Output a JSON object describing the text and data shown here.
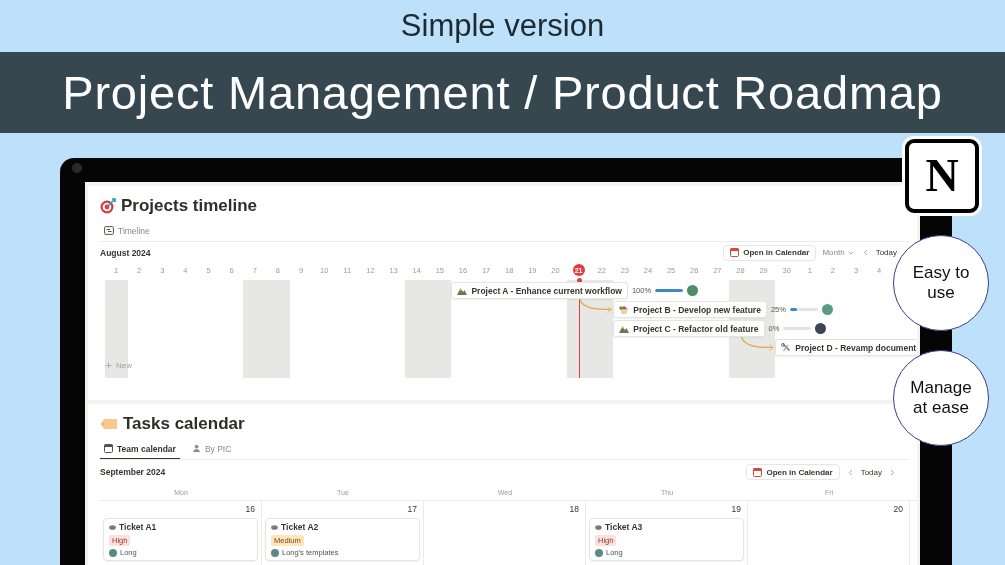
{
  "header": {
    "caption": "Simple version",
    "title": "Project Management / Product Roadmap"
  },
  "logo": {
    "letter": "N"
  },
  "badges": [
    "Easy to use",
    "Manage at ease"
  ],
  "timeline": {
    "title": "Projects timeline",
    "tab": "Timeline",
    "month": "August 2024",
    "open_calendar": "Open in Calendar",
    "scale": "Month",
    "today": "Today",
    "new": "New",
    "days": [
      {
        "label": "1",
        "shaded": true,
        "today": false
      },
      {
        "label": "2",
        "shaded": false,
        "today": false
      },
      {
        "label": "3",
        "shaded": false,
        "today": false
      },
      {
        "label": "4",
        "shaded": false,
        "today": false
      },
      {
        "label": "5",
        "shaded": false,
        "today": false
      },
      {
        "label": "6",
        "shaded": false,
        "today": false
      },
      {
        "label": "7",
        "shaded": true,
        "today": false
      },
      {
        "label": "8",
        "shaded": true,
        "today": false
      },
      {
        "label": "9",
        "shaded": false,
        "today": false
      },
      {
        "label": "10",
        "shaded": false,
        "today": false
      },
      {
        "label": "11",
        "shaded": false,
        "today": false
      },
      {
        "label": "12",
        "shaded": false,
        "today": false
      },
      {
        "label": "13",
        "shaded": false,
        "today": false
      },
      {
        "label": "14",
        "shaded": true,
        "today": false
      },
      {
        "label": "15",
        "shaded": true,
        "today": false
      },
      {
        "label": "16",
        "shaded": false,
        "today": false,
        "bars": [
          {
            "label": "Project A - Enhance current workflow",
            "progress": "100%",
            "level": 1,
            "avatar": {
              "color": "#4f8a6b"
            },
            "links_next": true
          }
        ]
      },
      {
        "label": "17",
        "shaded": false,
        "today": false
      },
      {
        "label": "18",
        "shaded": false,
        "today": false
      },
      {
        "label": "19",
        "shaded": false,
        "today": false
      },
      {
        "label": "20",
        "shaded": false,
        "today": false
      },
      {
        "label": "21",
        "shaded": true,
        "today": true
      },
      {
        "label": "22",
        "shaded": true,
        "today": false
      },
      {
        "label": "23",
        "shaded": false,
        "today": false,
        "bars": [
          {
            "label": "Project B - Develop new feature",
            "progress": "25%",
            "level": 0.25,
            "avatar": {
              "color": "#5b9a8a"
            },
            "links_next": false
          },
          {
            "label": "Project C - Refactor old feature",
            "progress": "0%",
            "level": 0,
            "avatar": {
              "color": "#3d4552"
            },
            "links_next": true
          }
        ]
      },
      {
        "label": "24",
        "shaded": false,
        "today": false
      },
      {
        "label": "25",
        "shaded": false,
        "today": false
      },
      {
        "label": "26",
        "shaded": false,
        "today": false
      },
      {
        "label": "27",
        "shaded": false,
        "today": false
      },
      {
        "label": "28",
        "shaded": true,
        "today": false
      },
      {
        "label": "29",
        "shaded": true,
        "today": false
      },
      {
        "label": "30",
        "shaded": false,
        "today": false,
        "bars": [
          {
            "label": "Project D - Revamp document",
            "links_next": false
          }
        ]
      },
      {
        "label": "1",
        "shaded": false,
        "today": false
      },
      {
        "label": "2",
        "shaded": false,
        "today": false
      },
      {
        "label": "3",
        "shaded": false,
        "today": false
      },
      {
        "label": "4",
        "shaded": false,
        "today": false
      }
    ]
  },
  "calendar": {
    "title": "Tasks calendar",
    "tabs": [
      {
        "label": "Team calendar",
        "selected": true
      },
      {
        "label": "By PIC",
        "selected": false
      }
    ],
    "month": "September 2024",
    "open_calendar": "Open in Calendar",
    "today": "Today",
    "weekdays": [
      "Mon",
      "Tue",
      "Wed",
      "Thu",
      "Fri"
    ],
    "cells": [
      {
        "date": "16",
        "tickets": [
          {
            "title": "Ticket A1",
            "priority": "High",
            "color": "#fde0dd",
            "person": "Long"
          }
        ]
      },
      {
        "date": "17",
        "tickets": [
          {
            "title": "Ticket A2",
            "priority": "Medium",
            "color": "#fbe7b8",
            "person": "Long's templates"
          }
        ]
      },
      {
        "date": "18"
      },
      {
        "date": "19",
        "tickets": [
          {
            "title": "Ticket A3",
            "priority": "High",
            "color": "#fde0dd",
            "person": "Long"
          }
        ]
      },
      {
        "date": "20"
      }
    ]
  }
}
